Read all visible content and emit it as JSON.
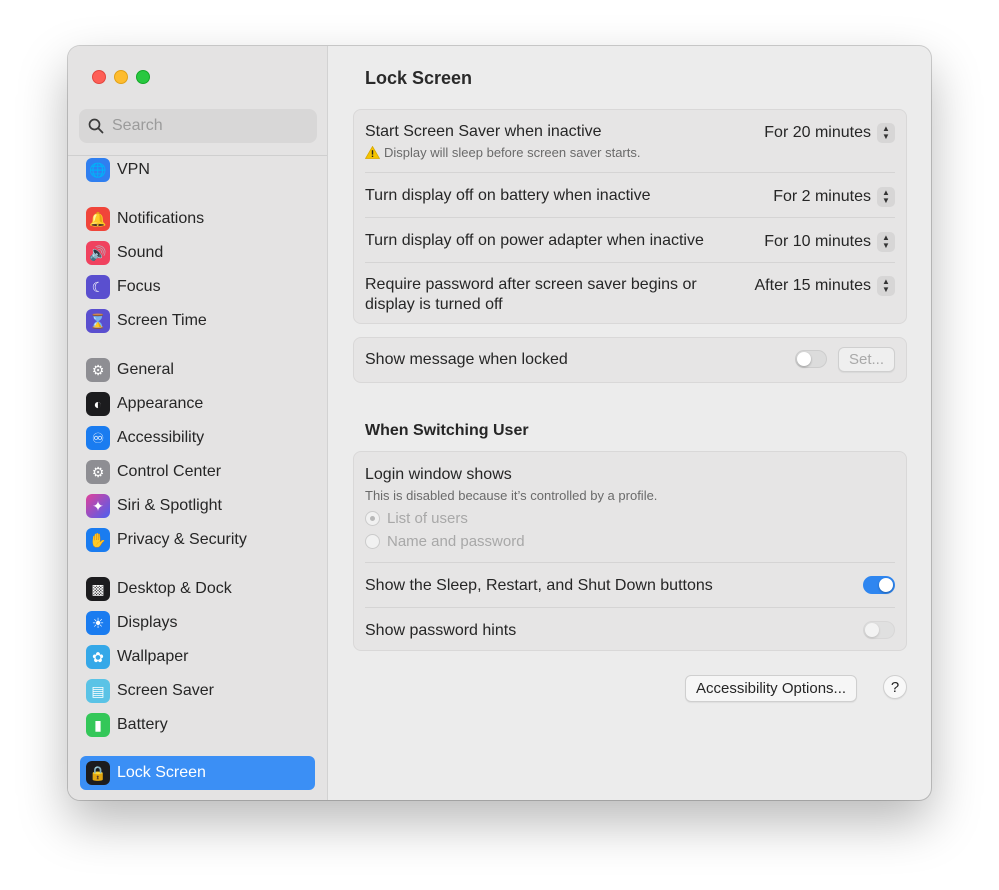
{
  "sidebar": {
    "search_placeholder": "Search",
    "items": [
      {
        "label": "VPN",
        "icon": "globe-icon",
        "color": "#2f7ff0"
      },
      {
        "label": "Notifications",
        "icon": "bell-icon",
        "color": "#f0453a"
      },
      {
        "label": "Sound",
        "icon": "speaker-icon",
        "color": "#f0425f"
      },
      {
        "label": "Focus",
        "icon": "moon-icon",
        "color": "#5a4fcf"
      },
      {
        "label": "Screen Time",
        "icon": "hourglass-icon",
        "color": "#5a4fcf"
      },
      {
        "label": "General",
        "icon": "gear-icon",
        "color": "#8e8e93"
      },
      {
        "label": "Appearance",
        "icon": "appearance-icon",
        "color": "#1c1c1e"
      },
      {
        "label": "Accessibility",
        "icon": "accessibility-icon",
        "color": "#1a7cf0"
      },
      {
        "label": "Control Center",
        "icon": "toggles-icon",
        "color": "#8e8e93"
      },
      {
        "label": "Siri & Spotlight",
        "icon": "siri-icon",
        "color": "#b43bd6"
      },
      {
        "label": "Privacy & Security",
        "icon": "hand-icon",
        "color": "#1a7cf0"
      },
      {
        "label": "Desktop & Dock",
        "icon": "dock-icon",
        "color": "#1c1c1e"
      },
      {
        "label": "Displays",
        "icon": "sun-icon",
        "color": "#1a7cf0"
      },
      {
        "label": "Wallpaper",
        "icon": "flower-icon",
        "color": "#35a8e8"
      },
      {
        "label": "Screen Saver",
        "icon": "screensaver-icon",
        "color": "#5ac3e6"
      },
      {
        "label": "Battery",
        "icon": "battery-icon",
        "color": "#34c759"
      },
      {
        "label": "Lock Screen",
        "icon": "lock-icon",
        "color": "#1c1c1e"
      }
    ]
  },
  "main": {
    "title": "Lock Screen",
    "screen_saver": {
      "label": "Start Screen Saver when inactive",
      "note": "Display will sleep before screen saver starts.",
      "value": "For 20 minutes"
    },
    "battery": {
      "label": "Turn display off on battery when inactive",
      "value": "For 2 minutes"
    },
    "power": {
      "label": "Turn display off on power adapter when inactive",
      "value": "For 10 minutes"
    },
    "password": {
      "label_line1": "Require password after screen saver begins or",
      "label_line2": "display is turned off",
      "value": "After 15 minutes"
    },
    "message": {
      "label": "Show message when locked",
      "button": "Set...",
      "enabled": false
    },
    "switching_title": "When Switching User",
    "login": {
      "label": "Login window shows",
      "note": "This is disabled because it’s controlled by a profile.",
      "options": [
        "List of users",
        "Name and password"
      ],
      "selected": "List of users"
    },
    "sleep_buttons": {
      "label": "Show the Sleep, Restart, and Shut Down buttons",
      "enabled": true
    },
    "hints": {
      "label": "Show password hints",
      "enabled": false
    },
    "accessibility_button": "Accessibility Options...",
    "help_label": "?"
  }
}
